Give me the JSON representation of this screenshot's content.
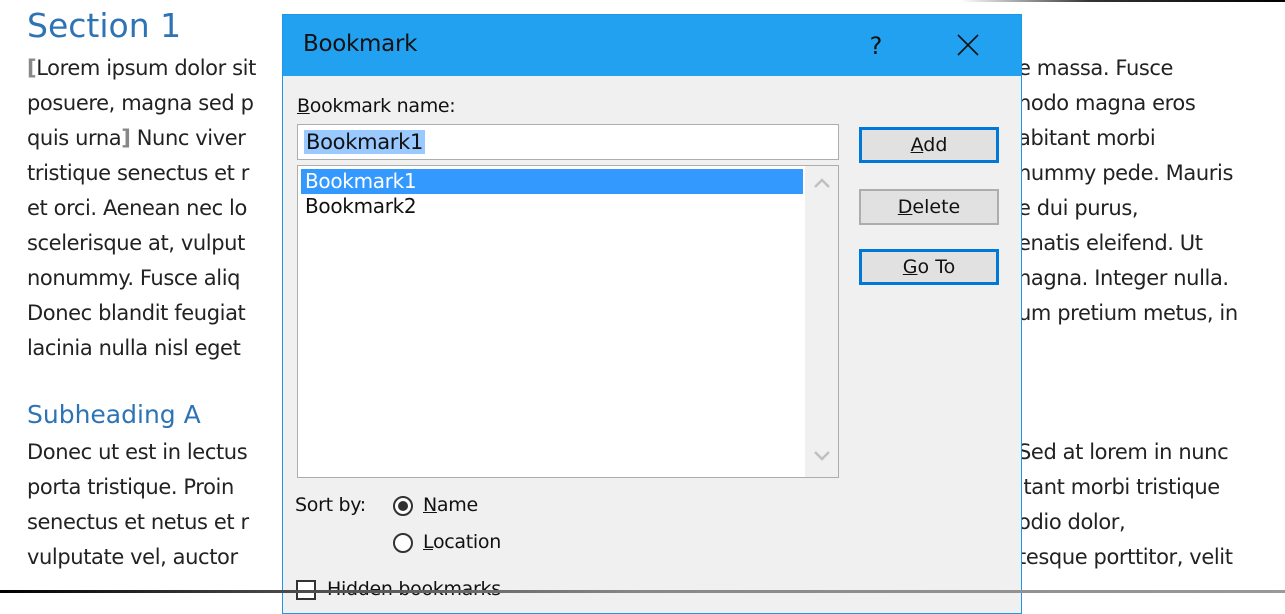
{
  "document": {
    "section_heading": "Section 1",
    "subheading": "Subheading A",
    "left_lines": [
      "Lorem ipsum dolor sit",
      "posuere, magna sed p",
      "quis urna",
      "tristique senectus et r",
      "et orci. Aenean nec lo",
      "scelerisque at, vulput",
      "nonummy. Fusce aliq",
      "Donec blandit feugiat",
      "lacinia nulla nisl eget"
    ],
    "left_line3_tail": " Nunc viver",
    "right_lines": [
      "e massa. Fusce",
      "nodo magna eros",
      "abitant morbi",
      "nummy pede. Mauris",
      "e dui purus,",
      "enatis eleifend. Ut",
      "nagna. Integer nulla.",
      "um pretium metus, in"
    ],
    "left_lines_b": [
      "Donec ut est in lectus",
      "porta tristique. Proin",
      "senectus et netus et r",
      "vulputate vel, auctor"
    ],
    "right_lines_b": [
      "Sed at lorem in nunc",
      "itant morbi tristique",
      " odio dolor,",
      "tesque porttitor, velit"
    ],
    "bookmark_open": "[",
    "bookmark_close": "]"
  },
  "dialog": {
    "title": "Bookmark",
    "help_label": "?",
    "name_label_mnemonic": "B",
    "name_label_rest": "ookmark name:",
    "name_value": "Bookmark1",
    "bookmarks": [
      "Bookmark1",
      "Bookmark2"
    ],
    "selected_index": 0,
    "buttons": {
      "add_m": "A",
      "add_rest": "dd",
      "delete_m": "D",
      "delete_rest": "elete",
      "goto_m": "G",
      "goto_rest": "o To"
    },
    "sort_by_label": "Sort by:",
    "sort_options": [
      {
        "m": "N",
        "rest": "ame",
        "checked": true
      },
      {
        "m": "L",
        "rest": "ocation",
        "checked": false
      }
    ],
    "hidden_bookmarks_label": "Hidden bookmarks",
    "hidden_bookmarks_checked": false
  }
}
